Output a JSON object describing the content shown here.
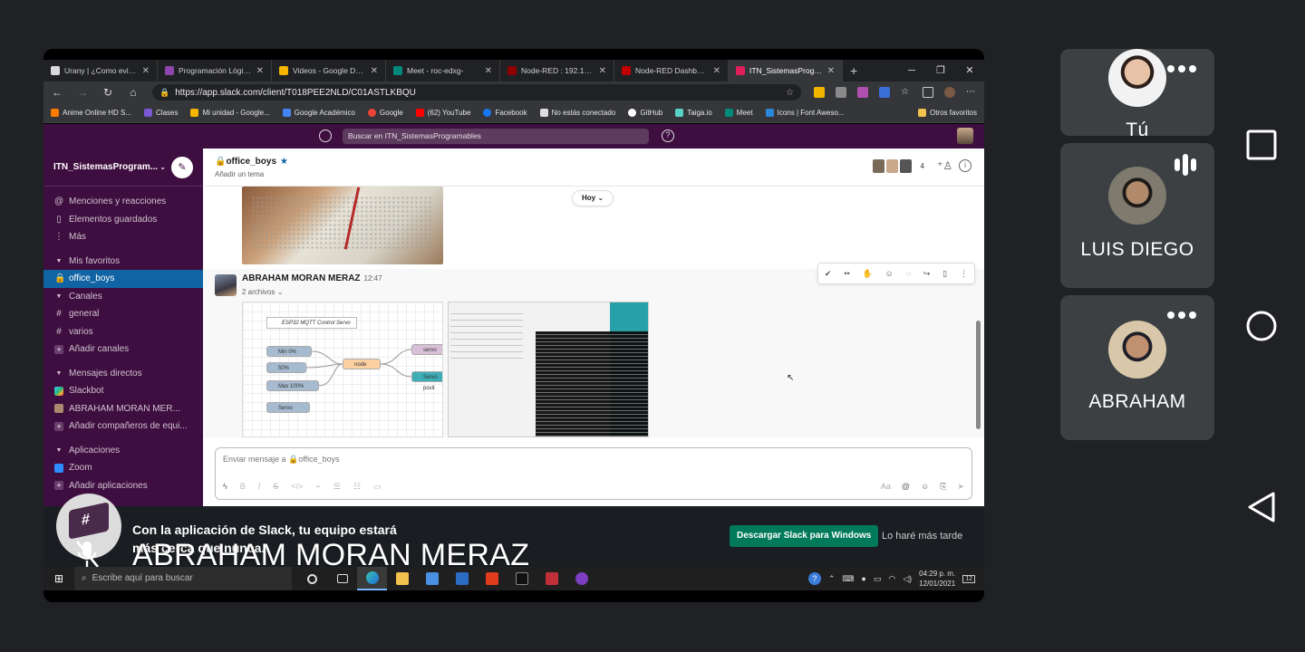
{
  "browser": {
    "tabs": [
      {
        "label": "Urany | ¿Como evitar s",
        "color": "#d9d9d9",
        "active": false
      },
      {
        "label": "Programación Lógica y",
        "color": "#8e44ad",
        "active": false
      },
      {
        "label": "Videos - Google Drive",
        "color": "#f4b400",
        "active": false
      },
      {
        "label": "Meet - roc-edxg-",
        "color": "#00897b",
        "active": false
      },
      {
        "label": "Node-RED : 192.168.0.",
        "color": "#8f0000",
        "active": false
      },
      {
        "label": "Node-RED Dashboard",
        "color": "#c00000",
        "active": false
      },
      {
        "label": "ITN_SistemasPrograma",
        "color": "#e01e5a",
        "active": true
      }
    ],
    "new_tab": "+",
    "window_controls": [
      "─",
      "❐",
      "✕"
    ],
    "url": "https://app.slack.com/client/T018PEE2NLD/C01ASTLKBQU",
    "bookmarks": [
      {
        "label": "Anime Online HD S...",
        "color": "#ff7a00"
      },
      {
        "label": "Clases",
        "color": "#7b57d1"
      },
      {
        "label": "Mi unidad - Google...",
        "color": "#f4b400"
      },
      {
        "label": "Google Académico",
        "color": "#4285f4"
      },
      {
        "label": "Google",
        "color": "#ea4335"
      },
      {
        "label": "(62) YouTube",
        "color": "#ff0000"
      },
      {
        "label": "Facebook",
        "color": "#1877f2"
      },
      {
        "label": "No estás conectado",
        "color": "#dddddd"
      },
      {
        "label": "GitHub",
        "color": "#ffffff"
      },
      {
        "label": "Taiga.io",
        "color": "#5ad1c7"
      },
      {
        "label": "Meet",
        "color": "#00897b"
      },
      {
        "label": "Icons | Font Aweso...",
        "color": "#2b88d8"
      }
    ],
    "other_bookmarks": "Otros favoritos"
  },
  "slack": {
    "search_placeholder": "Buscar en ITN_SistemasProgramables",
    "workspace": "ITN_SistemasProgram...",
    "sidebar": {
      "mentions": "Menciones y reacciones",
      "saved": "Elementos guardados",
      "more": "Más",
      "favorites_header": "Mis favoritos",
      "favorite_channel": "office_boys",
      "channels_header": "Canales",
      "channels": [
        "general",
        "varios"
      ],
      "add_channels": "Añadir canales",
      "dm_header": "Mensajes directos",
      "dms": [
        "Slackbot",
        "ABRAHAM MORAN MER..."
      ],
      "add_teammates": "Añadir compañeros de equi...",
      "apps_header": "Aplicaciones",
      "apps": [
        "Zoom"
      ],
      "add_apps": "Añadir aplicaciones"
    },
    "channel": {
      "name": "office_boys",
      "topic": "Añadir un tema",
      "member_count": "4"
    },
    "day_divider": "Hoy",
    "message": {
      "sender": "ABRAHAM MORAN MERAZ",
      "time": "12:47",
      "files": "2 archivos"
    },
    "nodered": {
      "comment": "ESP32 MQTT Control Servo",
      "inputs": [
        "Min 0%",
        "50%",
        "Max 100%",
        "Servo"
      ],
      "node": "node",
      "outputs": [
        "servo",
        "Servo posit"
      ]
    },
    "composer_placeholder": "Enviar mensaje a 🔒office_boys",
    "banner": {
      "text": "Con la aplicación de Slack, tu equipo estará más cerca que nunca.",
      "download_button": "Descargar Slack para Windows",
      "later": "Lo haré más tarde"
    }
  },
  "overlay": {
    "speaker_name": "ABRAHAM MORAN MERAZ"
  },
  "taskbar": {
    "search_placeholder": "Escribe aquí para buscar",
    "time": "04:29 p. m.",
    "date": "12/01/2021",
    "notification_count": "12"
  },
  "participants": [
    {
      "name": "Tú",
      "status": "more-options"
    },
    {
      "name": "LUIS DIEGO",
      "status": "speaking"
    },
    {
      "name": "ABRAHAM",
      "status": "more-options"
    }
  ]
}
